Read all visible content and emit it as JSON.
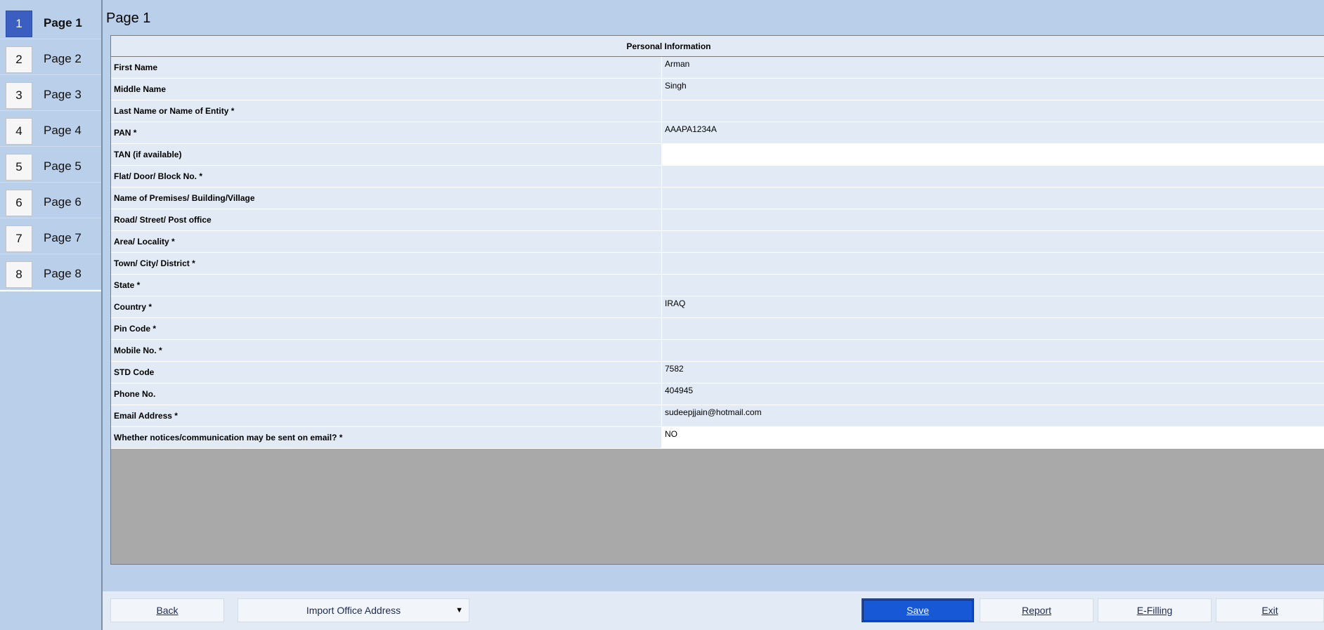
{
  "sidebar": {
    "items": [
      {
        "num": "1",
        "label": "Page 1"
      },
      {
        "num": "2",
        "label": "Page 2"
      },
      {
        "num": "3",
        "label": "Page 3"
      },
      {
        "num": "4",
        "label": "Page 4"
      },
      {
        "num": "5",
        "label": "Page 5"
      },
      {
        "num": "6",
        "label": "Page 6"
      },
      {
        "num": "7",
        "label": "Page 7"
      },
      {
        "num": "8",
        "label": "Page 8"
      }
    ]
  },
  "main": {
    "title": "Page 1",
    "section_header": "Personal Information",
    "rows": [
      {
        "label": "First Name",
        "value": "Arman"
      },
      {
        "label": "Middle Name",
        "value": "Singh"
      },
      {
        "label": "Last Name or Name of Entity *",
        "value": ""
      },
      {
        "label": "PAN *",
        "value": "AAAPA1234A"
      },
      {
        "label": "TAN (if available)",
        "value": ""
      },
      {
        "label": "Flat/ Door/ Block No. *",
        "value": ""
      },
      {
        "label": "Name of Premises/ Building/Village",
        "value": ""
      },
      {
        "label": "Road/ Street/ Post office",
        "value": ""
      },
      {
        "label": "Area/ Locality *",
        "value": ""
      },
      {
        "label": "Town/ City/ District *",
        "value": ""
      },
      {
        "label": "State *",
        "value": ""
      },
      {
        "label": "Country *",
        "value": "IRAQ"
      },
      {
        "label": "Pin Code *",
        "value": ""
      },
      {
        "label": "Mobile No. *",
        "value": ""
      },
      {
        "label": "STD Code",
        "value": "7582"
      },
      {
        "label": "Phone No.",
        "value": "404945"
      },
      {
        "label": "Email Address *",
        "value": "sudeepjjain@hotmail.com"
      },
      {
        "label": "Whether notices/communication may be sent on email? *",
        "value": "NO"
      }
    ]
  },
  "footer": {
    "back_label": "Back",
    "import_label": "Import Office Address",
    "save_label": "Save",
    "report_label": "Report",
    "efiling_label": "E-Filling",
    "exit_label": "Exit"
  }
}
